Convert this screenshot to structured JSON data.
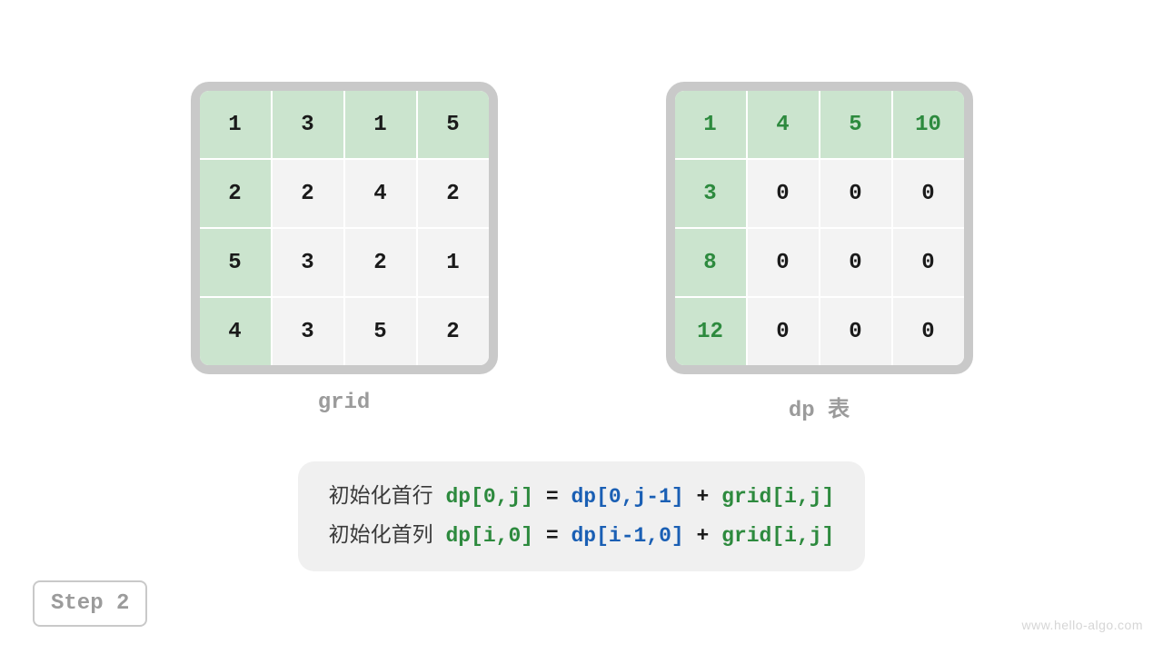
{
  "grid": {
    "label": "grid",
    "rows": [
      [
        {
          "v": "1",
          "h": true
        },
        {
          "v": "3",
          "h": true
        },
        {
          "v": "1",
          "h": true
        },
        {
          "v": "5",
          "h": true
        }
      ],
      [
        {
          "v": "2",
          "h": true
        },
        {
          "v": "2"
        },
        {
          "v": "4"
        },
        {
          "v": "2"
        }
      ],
      [
        {
          "v": "5",
          "h": true
        },
        {
          "v": "3"
        },
        {
          "v": "2"
        },
        {
          "v": "1"
        }
      ],
      [
        {
          "v": "4",
          "h": true
        },
        {
          "v": "3"
        },
        {
          "v": "5"
        },
        {
          "v": "2"
        }
      ]
    ]
  },
  "dp": {
    "label": "dp 表",
    "rows": [
      [
        {
          "v": "1",
          "h": true,
          "g": true
        },
        {
          "v": "4",
          "h": true,
          "g": true
        },
        {
          "v": "5",
          "h": true,
          "g": true
        },
        {
          "v": "10",
          "h": true,
          "g": true
        }
      ],
      [
        {
          "v": "3",
          "h": true,
          "g": true
        },
        {
          "v": "0"
        },
        {
          "v": "0"
        },
        {
          "v": "0"
        }
      ],
      [
        {
          "v": "8",
          "h": true,
          "g": true
        },
        {
          "v": "0"
        },
        {
          "v": "0"
        },
        {
          "v": "0"
        }
      ],
      [
        {
          "v": "12",
          "h": true,
          "g": true
        },
        {
          "v": "0"
        },
        {
          "v": "0"
        },
        {
          "v": "0"
        }
      ]
    ]
  },
  "formula": {
    "row1": {
      "prefix": "初始化首行 ",
      "p1": "dp[0,j]",
      "eq": " = ",
      "p2": "dp[0,j-1]",
      "plus": " + ",
      "p3": "grid[i,j]"
    },
    "row2": {
      "prefix": "初始化首列 ",
      "p1": "dp[i,0]",
      "eq": " = ",
      "p2": "dp[i-1,0]",
      "plus": " + ",
      "p3": "grid[i,j]"
    }
  },
  "step": "Step 2",
  "watermark": "www.hello-algo.com"
}
